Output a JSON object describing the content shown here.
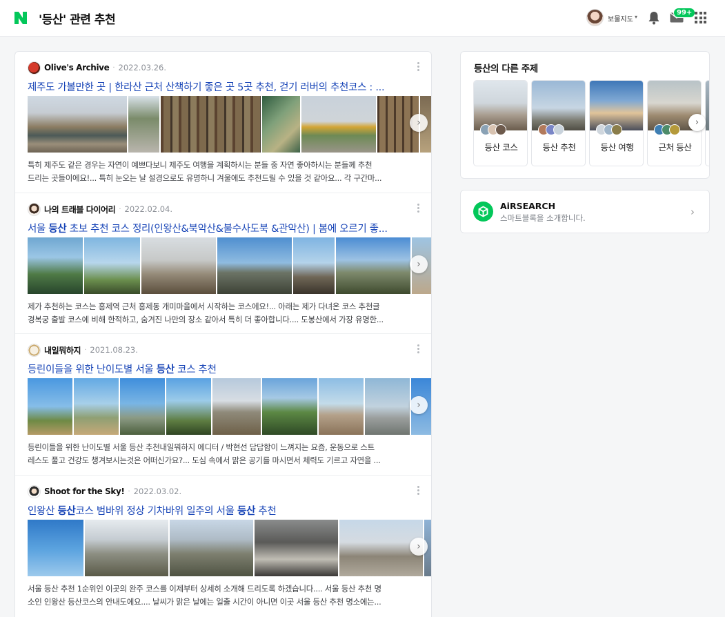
{
  "header": {
    "title": "'등산' 관련 추천",
    "username": "보물지도",
    "mail_badge": "99+"
  },
  "posts": [
    {
      "author": "Olive's Archive",
      "date": "2022.03.26.",
      "title": "제주도 가볼만한 곳 | 한라산 근처 산책하기 좋은 곳 5곳 추천, 걷기 러버의 추천코스 : ...",
      "desc_line1": "특히 제주도 같은 경우는 자연이 예쁘다보니 제주도 여행을 계획하시는 분들 중 자연 좋아하시는 분들께 추천",
      "desc_line2": "드리는 곳들이에요!... 특히 눈오는 날 설경으로도 유명하니 겨울에도 추천드릴 수 있을 것 같아요... 각 구간마..."
    },
    {
      "author": "나의 트래블 다이어리",
      "date": "2022.02.04.",
      "title_pre": "서울 ",
      "title_bold": "등산",
      "title_post": " 초보 추천 코스 정리(인왕산&북악산&불수사도북 &관악산) | 봄에 오르기 좋...",
      "desc_line1": "제가 추천하는 코스는 홍제역 근처 홍제동 개미마을에서 시작하는 코스에요!... 아래는 제가 다녀온 코스 추천글",
      "desc_line2": "경복궁 출발 코스에 비해 한적하고, 숨겨진 나만의 장소 같아서 특히 더 좋아합니다.... 도봉산에서 가장 유명한..."
    },
    {
      "author": "내일뭐하지",
      "date": "2021.08.23.",
      "title_pre": "등린이들을 위한 난이도별 서울 ",
      "title_bold": "등산",
      "title_post": " 코스 추천",
      "desc_line1": "등린이들을 위한 난이도별 서울 등산 추천내일뭐하지 에디터 / 박현선 답답함이 느껴지는 요즘, 운동으로 스트",
      "desc_line2": "레스도 풀고 건강도 챙겨보시는것은 어떠신가요?... 도심 속에서 맑은 공기를 마시면서 체력도 기르고 자연을 ..."
    },
    {
      "author": "Shoot for the Sky!",
      "date": "2022.03.02.",
      "title_pre": "인왕산 ",
      "title_bold": "등산",
      "title_mid": "코스 범바위 정상 기차바위 일주의 서울 ",
      "title_bold2": "등산",
      "title_post": " 추천",
      "desc_line1": "서울 등산 추천 1순위인 이곳의 완주 코스를 이제부터 상세히 소개해 드리도록 하겠습니다.... 서울 등산 추천 명",
      "desc_line2": "소인 인왕산 등산코스의 안내도에요.... 날씨가 맑은 날에는 일출 시간이 아니면 이곳 서울 등산 추천 명소에는..."
    }
  ],
  "side_topics": {
    "title": "등산의 다른 주제",
    "items": [
      "등산 코스",
      "등산 추천",
      "등산 여행",
      "근처 등산"
    ]
  },
  "airsearch": {
    "title": "AiRSEARCH",
    "subtitle": "스마트블록을 소개합니다."
  }
}
